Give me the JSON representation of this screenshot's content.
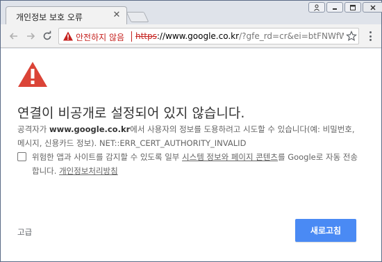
{
  "tab": {
    "title": "개인정보 보호 오류",
    "close_icon": "close-icon"
  },
  "toolbar": {
    "security_label": "안전하지 않음",
    "url_scheme": "https",
    "url_host": "://www.google.co.kr",
    "url_rest": "/?gfe_rd=cr&ei=btFNWfWmMa"
  },
  "content": {
    "heading": "연결이 비공개로 설정되어 있지 않습니다.",
    "desc_prefix": "공격자가 ",
    "desc_host": "www.google.co.kr",
    "desc_suffix": "에서 사용자의 정보를 도용하려고 시도할 수 있습니다(예: 비밀번호, 메시지, 신용카드 정보). NET::ERR_CERT_AUTHORITY_INVALID",
    "checkbox_prefix": "위험한 앱과 사이트를 감지할 수 있도록 일부 ",
    "checkbox_link": "시스템 정보와 페이지 콘텐츠",
    "checkbox_middle": "를 Google로 자동 전송합니다. ",
    "privacy_link": "개인정보처리방침",
    "advanced_label": "고급",
    "reload_label": "새로고침"
  },
  "colors": {
    "warning_red": "#db4437",
    "reload_blue": "#4a8af4"
  }
}
